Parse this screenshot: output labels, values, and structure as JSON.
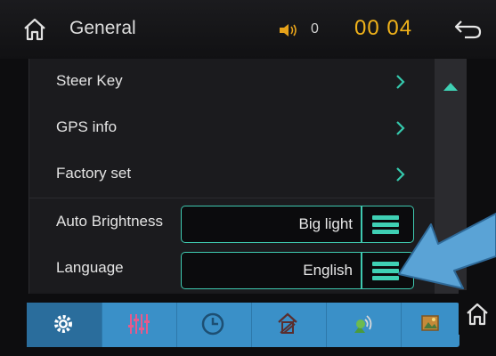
{
  "header": {
    "title": "General",
    "volume": "0",
    "clock": "00 04"
  },
  "settings": {
    "rows": [
      {
        "label": "Steer Key"
      },
      {
        "label": "GPS info"
      },
      {
        "label": "Factory set"
      },
      {
        "label": "Auto Brightness",
        "value": "Big light"
      },
      {
        "label": "Language",
        "value": "English"
      }
    ]
  },
  "tabs": [
    "settings",
    "equalizer",
    "clock",
    "navigation",
    "antenna",
    "picture"
  ],
  "icons": {
    "home": "home-icon",
    "volume": "speaker-icon",
    "back": "back-arrow-icon",
    "chevron": "chevron-right-icon",
    "scroll_up": "triangle-up-icon",
    "menu": "menu-icon"
  },
  "colors": {
    "accent": "#3fc9b0",
    "clock": "#f0b21a",
    "tabbar": "#3a90c8",
    "arrow": "#5aa3d6"
  }
}
